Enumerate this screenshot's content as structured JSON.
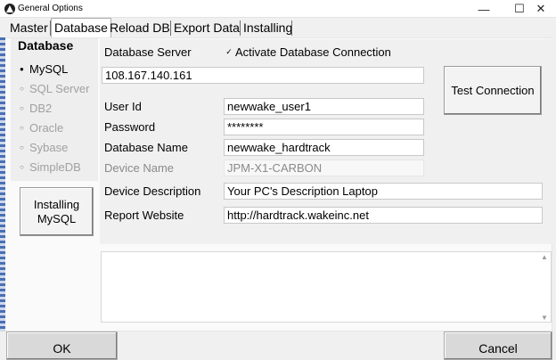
{
  "window": {
    "title": "General Options",
    "minimize": "—",
    "maximize": "☐",
    "close": "✕"
  },
  "tabs": [
    {
      "label": "Master",
      "active": false
    },
    {
      "label": "Database",
      "active": true
    },
    {
      "label": "Reload DB",
      "active": false
    },
    {
      "label": "Export Data",
      "active": false
    },
    {
      "label": "Installing",
      "active": false
    }
  ],
  "db_group": {
    "title": "Database",
    "options": [
      {
        "label": "MySQL",
        "selected": true
      },
      {
        "label": "SQL Server",
        "selected": false
      },
      {
        "label": "DB2",
        "selected": false
      },
      {
        "label": "Oracle",
        "selected": false
      },
      {
        "label": "Sybase",
        "selected": false
      },
      {
        "label": "SimpleDB",
        "selected": false
      }
    ]
  },
  "install_button": "Installing MySQL",
  "form": {
    "server_label": "Database Server",
    "activate_checked": true,
    "activate_label": "Activate Database Connection",
    "server_value": "108.167.140.161",
    "test_button": "Test Connection",
    "user_label": "User Id",
    "user_value": "newwake_user1",
    "password_label": "Password",
    "password_value": "********",
    "dbname_label": "Database Name",
    "dbname_value": "newwake_hardtrack",
    "device_label": "Device Name",
    "device_value": "JPM-X1-CARBON",
    "desc_label": "Device Description",
    "desc_value": "Your PC's Description Laptop",
    "report_label": "Report Website",
    "report_value": "http://hardtrack.wakeinc.net"
  },
  "memo": {
    "value": "",
    "scroll_up": "▲",
    "scroll_down": "▼"
  },
  "footer": {
    "ok": "OK",
    "cancel": "Cancel"
  }
}
